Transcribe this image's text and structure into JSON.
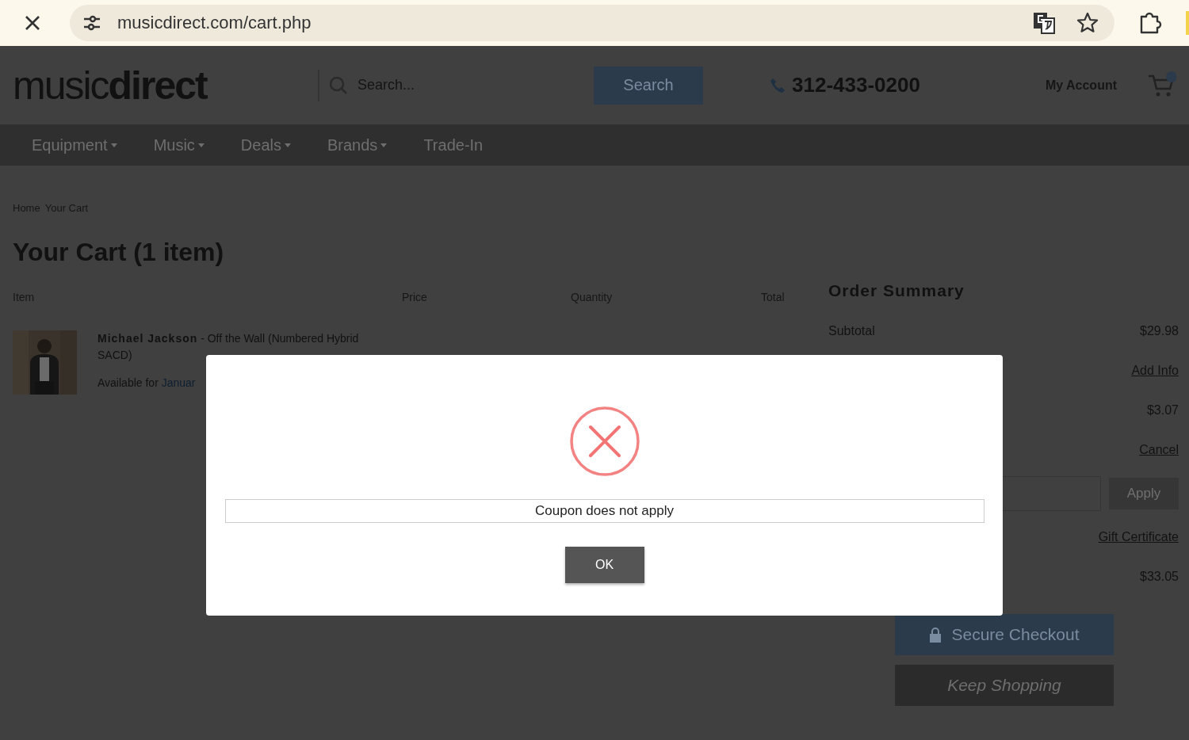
{
  "browser": {
    "url": "musicdirect.com/cart.php"
  },
  "header": {
    "logo": "music**direct**",
    "search_placeholder": "Search...",
    "search_button": "Search",
    "phone": "312-433-0200",
    "account": "My Account"
  },
  "nav": [
    {
      "label": "Equipment",
      "has_menu": true
    },
    {
      "label": "Music",
      "has_menu": true
    },
    {
      "label": "Deals",
      "has_menu": true
    },
    {
      "label": "Brands",
      "has_menu": true
    },
    {
      "label": "Trade-In",
      "has_menu": false
    }
  ],
  "breadcrumb": [
    "Home",
    "Your Cart"
  ],
  "cart": {
    "title": "Your Cart (1 item)",
    "columns": [
      "Item",
      "Price",
      "Quantity",
      "Total"
    ],
    "item": {
      "title": "**Michael Jackson** - Off the Wall (Numbered Hybrid SACD)",
      "availability": "Available for",
      "date": "Januar"
    }
  },
  "summary": {
    "title": "Order Summary",
    "rows": [
      {
        "kind": "amount",
        "label": "Subtotal",
        "value": "$29.98"
      },
      {
        "kind": "link",
        "value": "Add Info"
      },
      {
        "kind": "amount",
        "value": "$3.07"
      },
      {
        "kind": "link",
        "value": "Cancel"
      },
      {
        "kind": "coupon",
        "value": "Apply"
      },
      {
        "kind": "link",
        "value": "Gift Certificate"
      },
      {
        "kind": "amount",
        "value": "$33.05"
      }
    ],
    "buttons": [
      {
        "kind": "primary",
        "label": "Secure Checkout"
      },
      {
        "kind": "secondary",
        "label": "Keep Shopping"
      }
    ]
  },
  "dialog": {
    "message": "Coupon does not apply",
    "button": "OK"
  }
}
